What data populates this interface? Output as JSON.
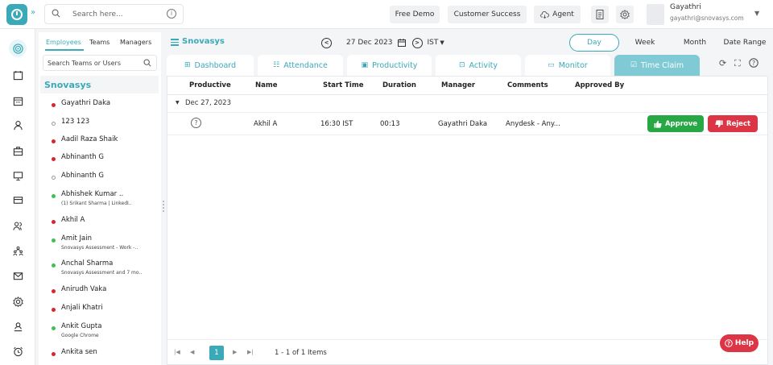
{
  "topbar": {
    "search_placeholder": "Search here...",
    "info_glyph": "i",
    "expand_glyph": "»",
    "free_demo": "Free Demo",
    "customer_success": "Customer Success",
    "agent": "Agent",
    "user_name": "Gayathri",
    "user_email": "gayathri@snovasys.com"
  },
  "left_nav_icons": [
    "activity-icon",
    "calendar-icon",
    "calendar-grid-icon",
    "user-icon",
    "briefcase-icon",
    "monitor-icon",
    "card-icon",
    "users-icon",
    "org-chart-icon",
    "mail-icon",
    "settings-icon",
    "person-badge-icon",
    "alarm-icon"
  ],
  "employee_panel": {
    "tabs": [
      "Employees",
      "Teams",
      "Managers"
    ],
    "search_placeholder": "Search Teams or Users",
    "org_name": "Snovasys",
    "employees": [
      {
        "name": "Gayathri Daka",
        "status": "red",
        "sub": ""
      },
      {
        "name": "123 123",
        "status": "empty",
        "sub": ""
      },
      {
        "name": "Aadil Raza Shaik",
        "status": "red",
        "sub": ""
      },
      {
        "name": "Abhinanth G",
        "status": "red",
        "sub": ""
      },
      {
        "name": "Abhinanth G",
        "status": "empty",
        "sub": ""
      },
      {
        "name": "Abhishek Kumar ..",
        "status": "green",
        "sub": "(1) Srikant Sharma | LinkedI.."
      },
      {
        "name": "Akhil A",
        "status": "red",
        "sub": ""
      },
      {
        "name": "Amit Jain",
        "status": "green",
        "sub": "Snovasys Assessment - Work -.."
      },
      {
        "name": "Anchal Sharma",
        "status": "green",
        "sub": "Snovasys Assessment and 7 mo.."
      },
      {
        "name": "Anirudh Vaka",
        "status": "red",
        "sub": ""
      },
      {
        "name": "Anjali Khatri",
        "status": "red",
        "sub": ""
      },
      {
        "name": "Ankit Gupta",
        "status": "green",
        "sub": "Google Chrome"
      },
      {
        "name": "Ankita sen",
        "status": "red",
        "sub": ""
      }
    ]
  },
  "header": {
    "org": "Snovasys",
    "prev_glyph": "<",
    "next_glyph": ">",
    "date": "27 Dec 2023",
    "timezone": "IST",
    "ranges": [
      "Day",
      "Week",
      "Month",
      "Date Range"
    ],
    "active_range": "Day"
  },
  "page_tabs": [
    {
      "label": "Dashboard",
      "icon": "dashboard-icon"
    },
    {
      "label": "Attendance",
      "icon": "attendance-icon"
    },
    {
      "label": "Productivity",
      "icon": "productivity-icon"
    },
    {
      "label": "Activity",
      "icon": "activity-icon"
    },
    {
      "label": "Monitor",
      "icon": "monitor-icon"
    },
    {
      "label": "Time Claim",
      "icon": "time-claim-icon"
    }
  ],
  "active_tab": "Time Claim",
  "grid": {
    "columns": [
      "Productive",
      "Name",
      "Start Time",
      "Duration",
      "Manager",
      "Comments",
      "Approved By"
    ],
    "group_label": "Dec 27, 2023",
    "group_caret": "▼",
    "rows": [
      {
        "productive": "?",
        "name": "Akhil A",
        "start_time": "16:30  IST",
        "duration": "00:13",
        "manager": "Gayathri Daka",
        "comments": "Anydesk - Any...",
        "approved_by": ""
      }
    ],
    "approve_label": "Approve",
    "reject_label": "Reject"
  },
  "pager": {
    "page": "1",
    "info": "1 - 1 of 1 Items"
  },
  "help_label": "Help",
  "colors": {
    "accent": "#3aa9b8",
    "approve": "#28a745",
    "reject": "#dc3545",
    "active_tab": "#7fcad4"
  }
}
